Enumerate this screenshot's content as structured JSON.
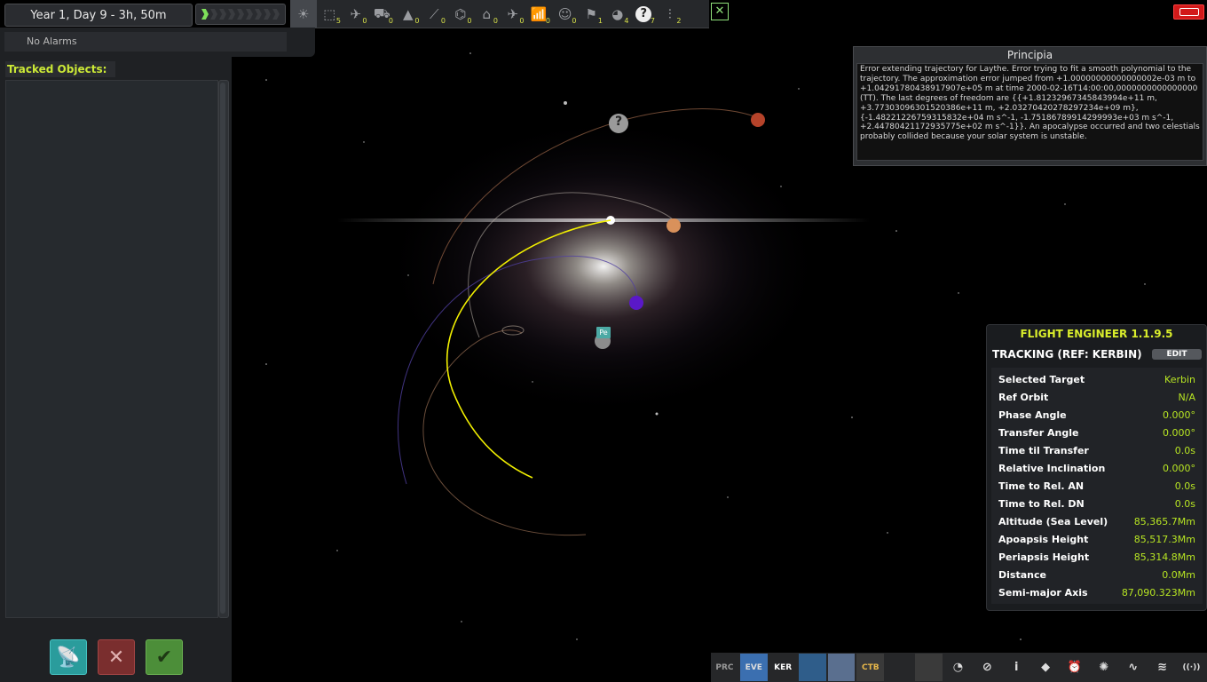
{
  "top_bar": {
    "date": "Year 1, Day 9 - 3h, 50m",
    "warp_total": 9,
    "warp_active": 1,
    "filters": [
      {
        "icon": "sun-icon",
        "count": ""
      },
      {
        "icon": "debris-icon",
        "count": "5"
      },
      {
        "icon": "probe-icon",
        "count": "0"
      },
      {
        "icon": "rover-icon",
        "count": "0"
      },
      {
        "icon": "lander-icon",
        "count": "0"
      },
      {
        "icon": "ship-icon",
        "count": "0"
      },
      {
        "icon": "station-icon",
        "count": "0"
      },
      {
        "icon": "base-icon",
        "count": "0"
      },
      {
        "icon": "plane-icon",
        "count": "0"
      },
      {
        "icon": "relay-icon",
        "count": "0"
      },
      {
        "icon": "eva-icon",
        "count": "0"
      },
      {
        "icon": "flag-icon",
        "count": "1"
      },
      {
        "icon": "planet-icon",
        "count": "4"
      },
      {
        "icon": "unknown-icon",
        "count": "7"
      },
      {
        "icon": "deployed-science-icon",
        "count": "2"
      }
    ],
    "unknown_glyph": "?"
  },
  "alarm": {
    "text": "No Alarms"
  },
  "tracking": {
    "header": "Tracked Objects:"
  },
  "principia": {
    "title": "Principia",
    "message": "Error extending trajectory for Laythe. Error trying to fit a smooth polynomial to the trajectory. The approximation error jumped from +1.00000000000000002e-03 m to +1.04291780438917907e+05 m at time 2000-02-16T14:00:00,0000000000000000 (TT). The last degrees of freedom are {{+1.81232967345843994e+11 m, +3.77303096301520386e+11 m, +2.03270420278297234e+09 m}, {-1.48221226759315832e+04 m s^-1, -1.75186789914299993e+03 m s^-1, +2.44780421172935775e+02 m s^-1}}. An apocalypse occurred and two celestials probably collided because your solar system is unstable."
  },
  "engineer": {
    "title": "FLIGHT ENGINEER 1.1.9.5",
    "section": "TRACKING (REF: KERBIN)",
    "edit_label": "EDIT",
    "rows": [
      {
        "label": "Selected Target",
        "value": "Kerbin"
      },
      {
        "label": "Ref Orbit",
        "value": "N/A"
      },
      {
        "label": "Phase Angle",
        "value": "0.000°"
      },
      {
        "label": "Transfer Angle",
        "value": "0.000°"
      },
      {
        "label": "Time til Transfer",
        "value": "0.0s"
      },
      {
        "label": "Relative Inclination",
        "value": "0.000°"
      },
      {
        "label": "Time to Rel. AN",
        "value": "0.0s"
      },
      {
        "label": "Time to Rel. DN",
        "value": "0.0s"
      },
      {
        "label": "Altitude (Sea Level)",
        "value": "85,365.7Mm"
      },
      {
        "label": "Apoapsis Height",
        "value": "85,517.3Mm"
      },
      {
        "label": "Periapsis Height",
        "value": "85,314.8Mm"
      },
      {
        "label": "Distance",
        "value": "0.0Mm"
      },
      {
        "label": "Semi-major Axis",
        "value": "87,090.323Mm"
      }
    ]
  },
  "map": {
    "pe_label": "Pe",
    "unknown_marker": "?"
  },
  "app_bar": {
    "items": [
      {
        "name": "rpm-app-button",
        "label": "PRC"
      },
      {
        "name": "eve-app-button",
        "label": "EVE"
      },
      {
        "name": "ker-app-button",
        "label": "KER"
      },
      {
        "name": "scansat-app-button",
        "label": ""
      },
      {
        "name": "science-app-button",
        "label": ""
      },
      {
        "name": "ctb-app-button",
        "label": "CTB"
      },
      {
        "name": "tools-app-button",
        "label": ""
      },
      {
        "name": "wrench-app-button",
        "label": ""
      },
      {
        "name": "clock-app-button",
        "label": "◔"
      },
      {
        "name": "orbit-app-button",
        "label": "⊘"
      },
      {
        "name": "info-app-button",
        "label": "i"
      },
      {
        "name": "contracts-app-button",
        "label": "◆"
      },
      {
        "name": "alarm-clock-app-button",
        "label": "⏰"
      },
      {
        "name": "plasma-app-button",
        "label": "✺"
      },
      {
        "name": "signal-app-button",
        "label": "∿"
      },
      {
        "name": "antenna-app-button",
        "label": "≋"
      },
      {
        "name": "commnet-app-button",
        "label": "((·))"
      }
    ]
  }
}
